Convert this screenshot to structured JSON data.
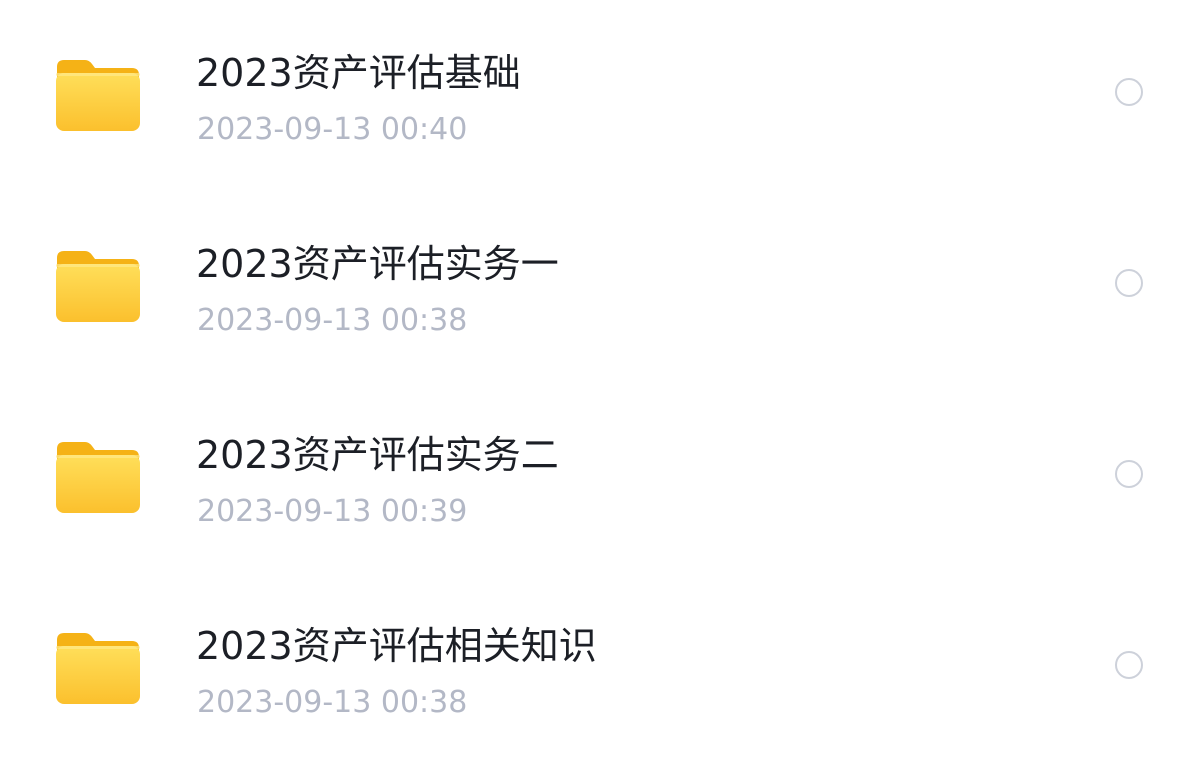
{
  "colors": {
    "folder_tab": "#f5b216",
    "folder_body_top": "#ffdf5a",
    "folder_body_bottom": "#fbc02d",
    "title_text": "#1c1f26",
    "date_text": "#b3b8c6",
    "radio_border": "#cdd1da"
  },
  "files": [
    {
      "icon": "folder-icon",
      "name": "2023资产评估基础",
      "modified": "2023-09-13 00:40",
      "selected": false
    },
    {
      "icon": "folder-icon",
      "name": "2023资产评估实务一",
      "modified": "2023-09-13 00:38",
      "selected": false
    },
    {
      "icon": "folder-icon",
      "name": "2023资产评估实务二",
      "modified": "2023-09-13 00:39",
      "selected": false
    },
    {
      "icon": "folder-icon",
      "name": "2023资产评估相关知识",
      "modified": "2023-09-13 00:38",
      "selected": false
    }
  ]
}
